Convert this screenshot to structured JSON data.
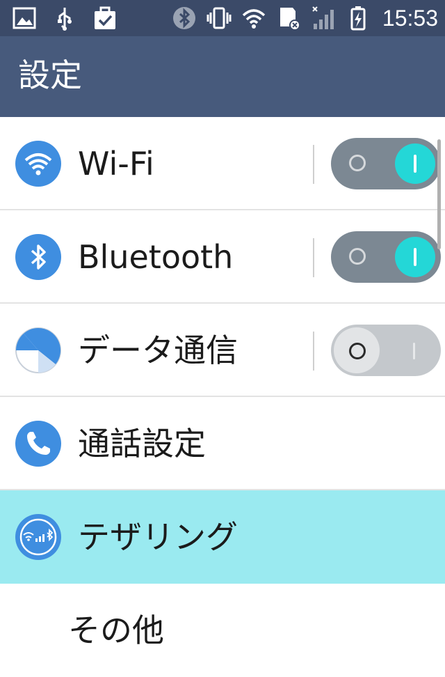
{
  "status_bar": {
    "time": "15:53",
    "left_icons": [
      "image-icon",
      "usb-icon",
      "task-check-icon"
    ],
    "right_icons": [
      "bluetooth-icon",
      "vibrate-icon",
      "wifi-signal-icon",
      "sd-card-error-icon",
      "cell-signal-icon",
      "battery-charging-icon"
    ]
  },
  "action_bar": {
    "title": "設定"
  },
  "settings": [
    {
      "label": "Wi-Fi",
      "icon": "wifi-icon",
      "toggle": true,
      "state": "on"
    },
    {
      "label": "Bluetooth",
      "icon": "bluetooth-icon",
      "toggle": true,
      "state": "on"
    },
    {
      "label": "データ通信",
      "icon": "data-usage-icon",
      "toggle": true,
      "state": "off"
    },
    {
      "label": "通話設定",
      "icon": "phone-icon",
      "toggle": false
    },
    {
      "label": "テザリング",
      "icon": "tethering-icon",
      "toggle": false,
      "selected": true
    },
    {
      "label": "その他",
      "icon": "",
      "toggle": false
    }
  ],
  "colors": {
    "status_bar": "#3b4a68",
    "action_bar": "#475a7c",
    "icon_blue": "#3f8ee0",
    "toggle_on_knob": "#24d7d7",
    "highlight_row": "#9aeaf0"
  }
}
